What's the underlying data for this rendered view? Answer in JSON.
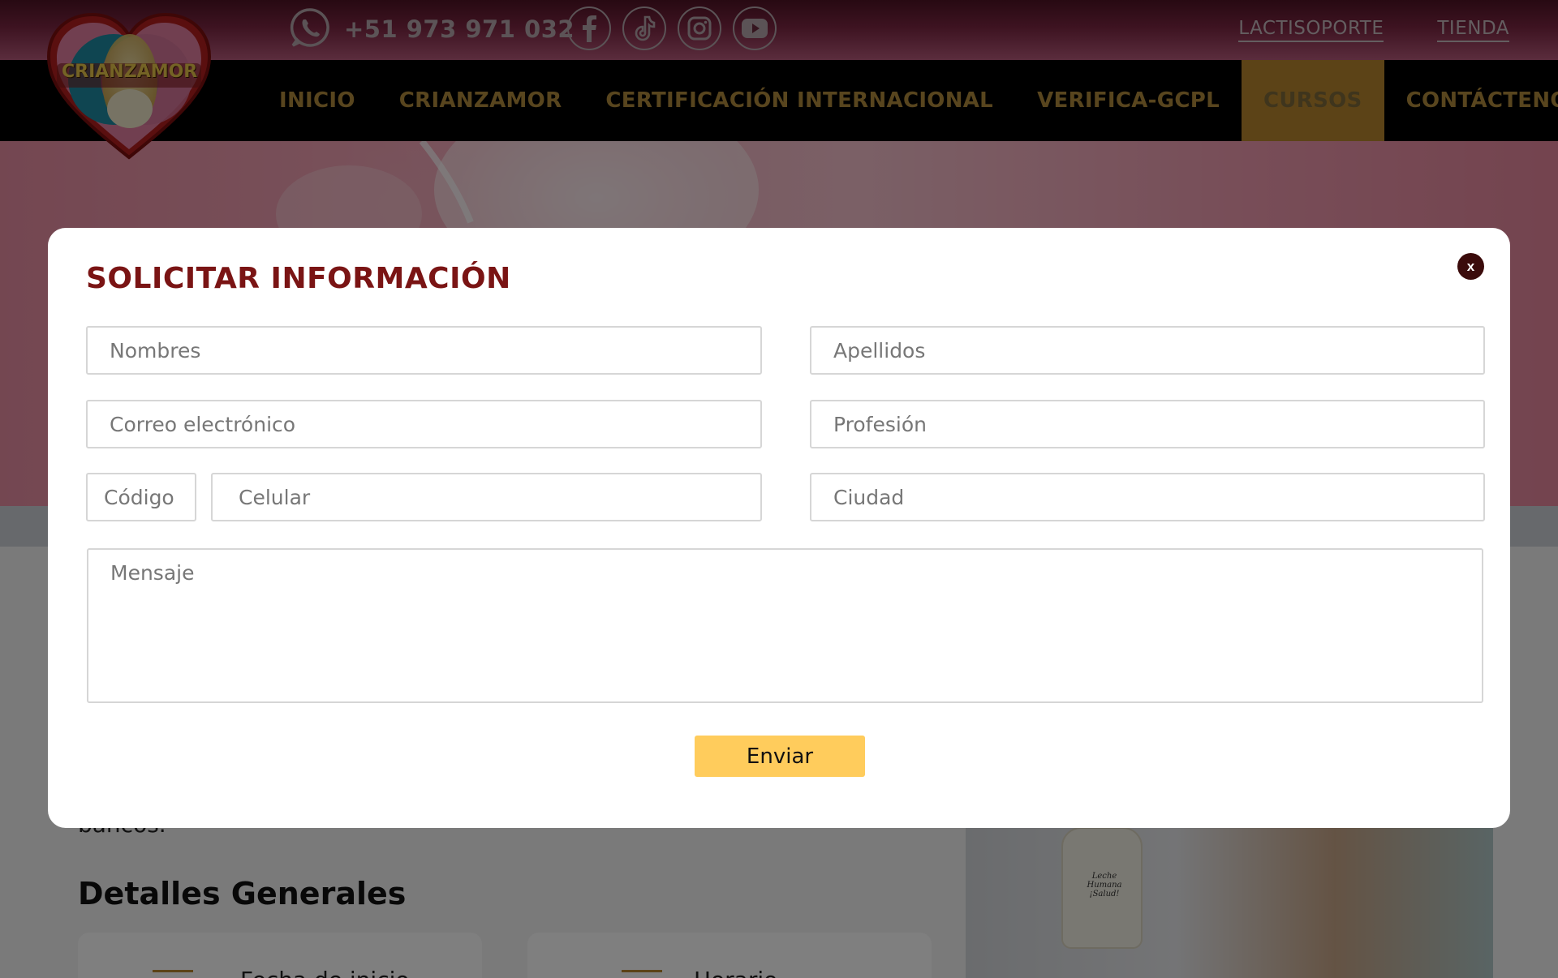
{
  "topbar": {
    "phone": "+51 973 971 032",
    "social": [
      "facebook-icon",
      "tiktok-icon",
      "instagram-icon",
      "youtube-icon"
    ],
    "links": [
      "LACTISOPORTE",
      "TIENDA"
    ]
  },
  "logo": {
    "text": "CRIANZAMOR"
  },
  "nav": {
    "items": [
      "INICIO",
      "CRIANZAMOR",
      "CERTIFICACIÓN INTERNACIONAL",
      "VERIFICA-GCPL",
      "CURSOS",
      "CONTÁCTENOS"
    ],
    "active": "CURSOS"
  },
  "content": {
    "text_fragment": "bancos.",
    "section_title": "Detalles Generales",
    "cards": [
      "Fecha de inicio",
      "Horario"
    ],
    "bottle_label": "Leche Humana ¡Salud!"
  },
  "modal": {
    "title": "SOLICITAR INFORMACIÓN",
    "close_label": "x",
    "fields": {
      "nombres": "Nombres",
      "apellidos": "Apellidos",
      "correo": "Correo electrónico",
      "profesion": "Profesión",
      "codigo": "Código",
      "celular": "Celular",
      "ciudad": "Ciudad",
      "mensaje": "Mensaje"
    },
    "submit_label": "Enviar"
  },
  "colors": {
    "topbar": "#7b2642",
    "nav_bg": "#000000",
    "nav_text": "#b08a3c",
    "active_tab": "#b8862e",
    "modal_title": "#7a1414",
    "submit": "#ffcc5c"
  }
}
